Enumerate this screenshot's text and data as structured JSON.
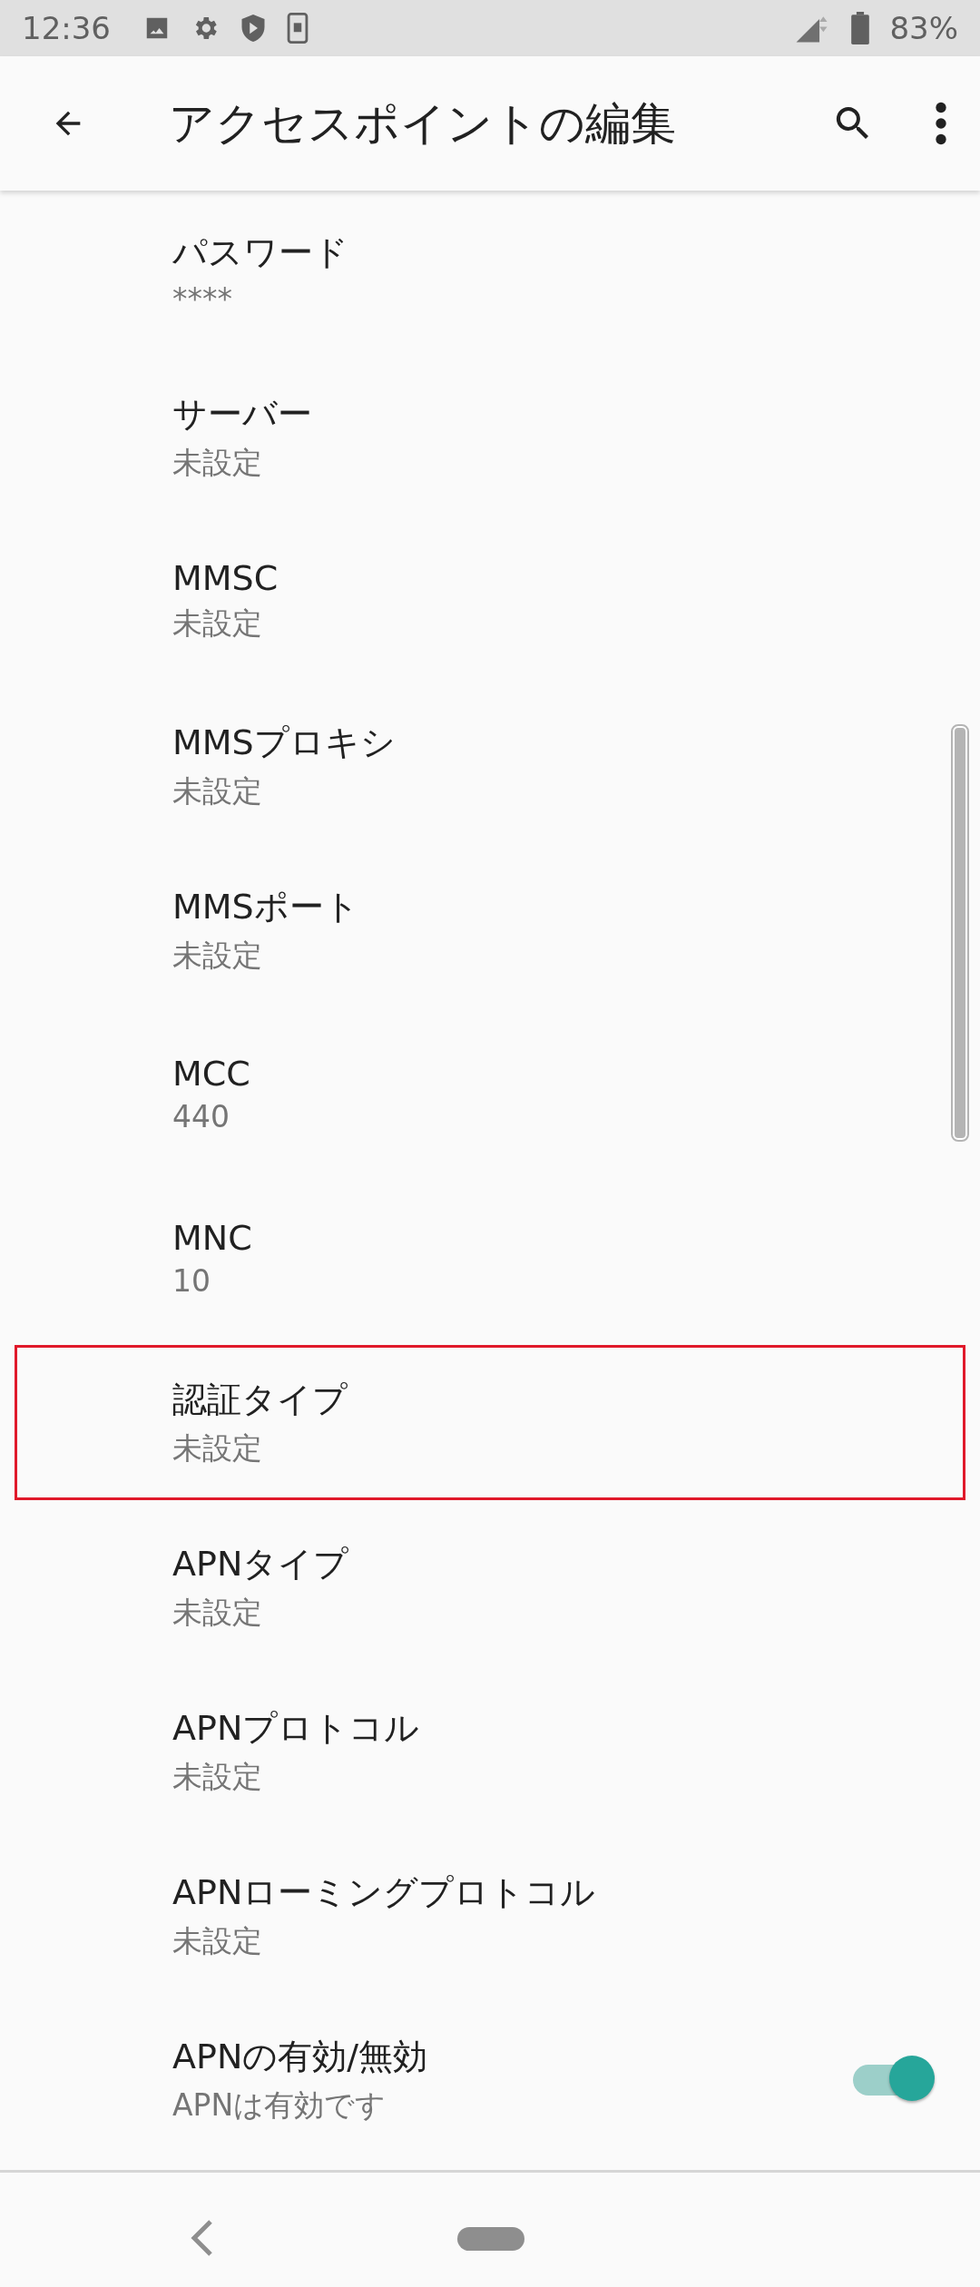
{
  "status_bar": {
    "time": "12:36",
    "battery": "83%"
  },
  "app_bar": {
    "title": "アクセスポイントの編集"
  },
  "items": [
    {
      "kind": "text",
      "title": "パスワード",
      "value": "****",
      "highlighted": false
    },
    {
      "kind": "text",
      "title": "サーバー",
      "value": "未設定",
      "highlighted": false
    },
    {
      "kind": "text",
      "title": "MMSC",
      "value": "未設定",
      "highlighted": false
    },
    {
      "kind": "text",
      "title": "MMSプロキシ",
      "value": "未設定",
      "highlighted": false
    },
    {
      "kind": "text",
      "title": "MMSポート",
      "value": "未設定",
      "highlighted": false
    },
    {
      "kind": "text",
      "title": "MCC",
      "value": "440",
      "highlighted": false
    },
    {
      "kind": "text",
      "title": "MNC",
      "value": "10",
      "highlighted": false
    },
    {
      "kind": "text",
      "title": "認証タイプ",
      "value": "未設定",
      "highlighted": true
    },
    {
      "kind": "text",
      "title": "APNタイプ",
      "value": "未設定",
      "highlighted": false
    },
    {
      "kind": "text",
      "title": "APNプロトコル",
      "value": "未設定",
      "highlighted": false
    },
    {
      "kind": "text",
      "title": "APNローミングプロトコル",
      "value": "未設定",
      "highlighted": false
    },
    {
      "kind": "switch",
      "title": "APNの有効/無効",
      "value": "APNは有効です",
      "on": true,
      "highlighted": false
    }
  ]
}
